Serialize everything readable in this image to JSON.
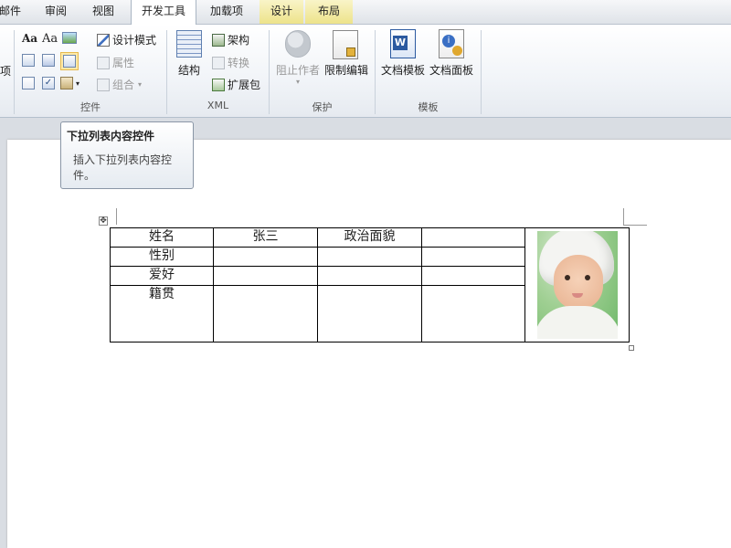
{
  "tabs": [
    {
      "label": "邮件",
      "active": false
    },
    {
      "label": "审阅",
      "active": false
    },
    {
      "label": "视图",
      "active": false
    },
    {
      "label": "开发工具",
      "active": true
    },
    {
      "label": "加载项",
      "active": false
    },
    {
      "label": "设计",
      "active": false,
      "contextual": true
    },
    {
      "label": "布局",
      "active": false,
      "contextual": true
    }
  ],
  "ribbon": {
    "partial_left_label": "项",
    "controls": {
      "label": "控件",
      "design_mode": "设计模式",
      "properties": "属性",
      "group": "组合",
      "rich_text_glyph": "Aa",
      "plain_text_glyph": "Aa"
    },
    "xml": {
      "label": "XML",
      "structure": "结构",
      "schema": "架构",
      "transform": "转换",
      "expansion_pack": "扩展包"
    },
    "protect": {
      "label": "保护",
      "block_authors": "阻止作者",
      "restrict_editing": "限制编辑"
    },
    "templates": {
      "label": "模板",
      "document_template": "文档模板",
      "document_panel": "文档面板"
    }
  },
  "tooltip": {
    "title": "下拉列表内容控件",
    "description": "插入下拉列表内容控件。"
  },
  "table": {
    "rows": [
      [
        "姓名",
        "张三",
        "政治面貌",
        ""
      ],
      [
        "性别",
        "",
        "",
        ""
      ],
      [
        "爱好",
        "",
        "",
        ""
      ],
      [
        "籍贯",
        "",
        "",
        ""
      ]
    ]
  },
  "colors": {
    "active_tab": "#ffffff",
    "contextual_tab": "#ede38a",
    "ribbon_bg": "#f1f4f8",
    "document_bg": "#d9dde3"
  }
}
